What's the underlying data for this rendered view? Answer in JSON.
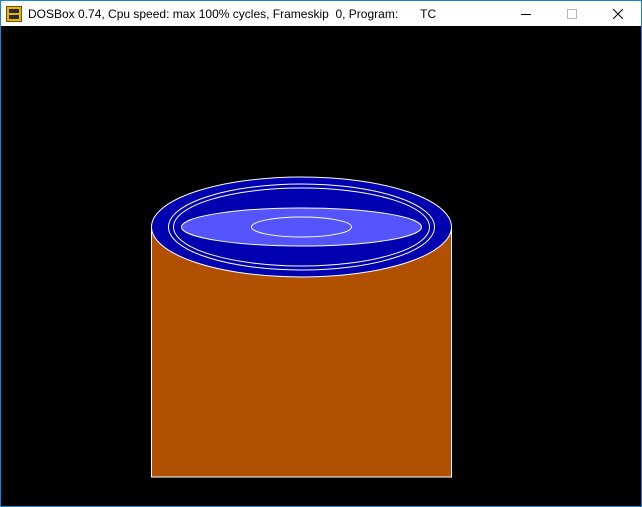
{
  "window": {
    "title_prefix": "DOSBox 0.74, Cpu speed: max 100% cycles, Frameskip  0, Program:",
    "program": "TC",
    "icon": "dosbox-icon",
    "controls": [
      "minimize-icon",
      "maximize-icon",
      "close-icon"
    ]
  },
  "colors": {
    "background": "#000000",
    "cylinder_body": "#b05000",
    "outline": "#ffffff",
    "ring_dark": "#0000b0",
    "ring_light": "#5555ff"
  }
}
